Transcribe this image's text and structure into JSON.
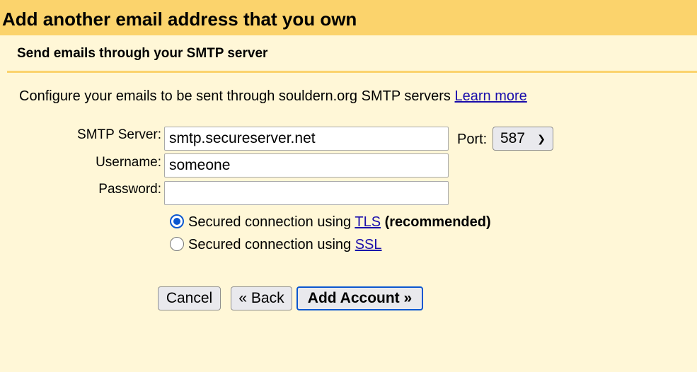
{
  "header": {
    "title": "Add another email address that you own"
  },
  "section": {
    "subtitle": "Send emails through your SMTP server"
  },
  "intro": {
    "text": "Configure your emails to be sent through souldern.org SMTP servers",
    "learn_more": "Learn more"
  },
  "form": {
    "smtp_label": "SMTP Server:",
    "smtp_value": "smtp.secureserver.net",
    "port_label": "Port:",
    "port_value": "587",
    "username_label": "Username:",
    "username_value": "someone",
    "password_label": "Password:",
    "password_value": ""
  },
  "security": {
    "tls": {
      "prefix": "Secured connection using",
      "link": "TLS",
      "suffix": "(recommended)",
      "selected": true
    },
    "ssl": {
      "prefix": "Secured connection using",
      "link": "SSL",
      "selected": false
    }
  },
  "buttons": {
    "cancel": "Cancel",
    "back": "« Back",
    "add": "Add Account »"
  },
  "colors": {
    "header_bg": "#fbd36c",
    "page_bg": "#fff7d7",
    "link": "#1a0dab",
    "accent": "#0b57d0"
  }
}
